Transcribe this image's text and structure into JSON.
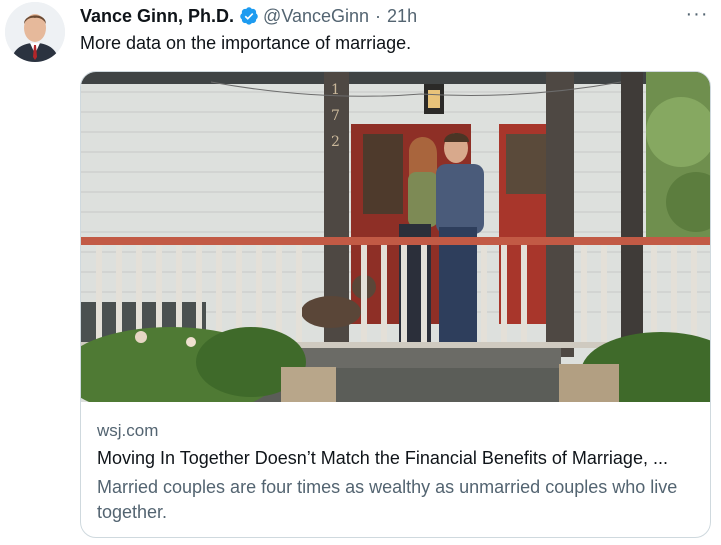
{
  "tweet": {
    "author_name": "Vance Ginn, Ph.D.",
    "handle": "@VanceGinn",
    "separator": "·",
    "time": "21h",
    "text": "More data on the importance of marriage.",
    "more_glyph": "···"
  },
  "card": {
    "domain": "wsj.com",
    "title": "Moving In Together Doesn’t Match the Financial Benefits of Marriage, ...",
    "description": "Married couples are four times as wealthy as unmarried couples who live together.",
    "image_house_number": [
      "1",
      "7",
      "2"
    ]
  },
  "colors": {
    "verified": "#1d9bf0",
    "secondary_text": "#536471",
    "primary_text": "#0f1419",
    "border": "#cfd9de"
  },
  "icons": {
    "verified": "verified-badge-icon",
    "more": "more-options-icon"
  }
}
